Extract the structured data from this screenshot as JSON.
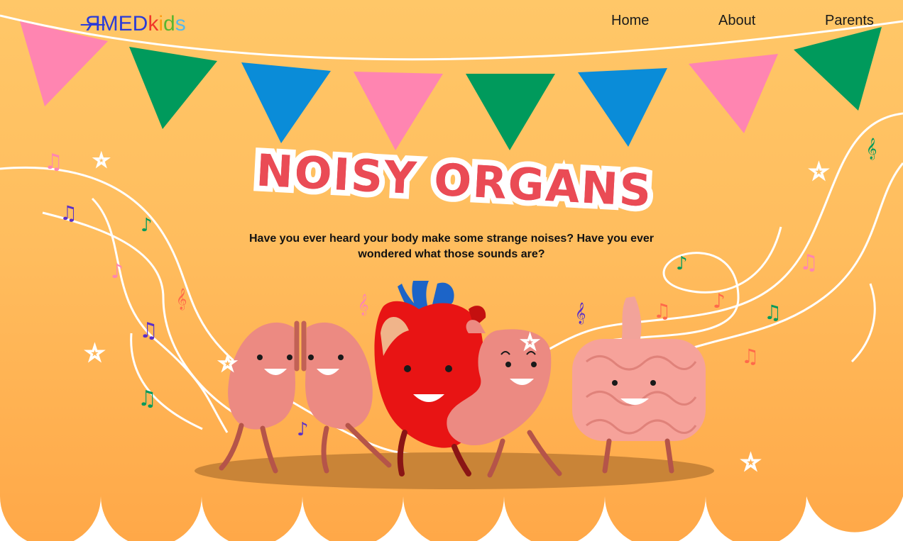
{
  "brand": {
    "logo_text": "RMEDkids",
    "logo_colors": [
      "#2a3bd8",
      "#f0372a",
      "#ff9b10",
      "#5bb52f",
      "#59b8e8"
    ]
  },
  "nav": {
    "items": [
      {
        "label": "Home"
      },
      {
        "label": "About"
      },
      {
        "label": "Parents"
      }
    ]
  },
  "hero": {
    "title": "NOISY ORGANS",
    "subtitle": "Have you ever heard your body make some strange noises? Have you ever wondered what those sounds are?"
  },
  "colors": {
    "background": "#ffc768",
    "title": "#ea4b55",
    "bunting": [
      "#ff85b1",
      "#009a5c",
      "#0a8cd8"
    ],
    "heart": "#e81414",
    "organ_pink": "#ec8a82"
  },
  "illustration": {
    "characters": [
      "lungs",
      "heart",
      "stomach",
      "intestines"
    ],
    "icons": [
      "music-note-icon",
      "treble-clef-icon",
      "star-icon"
    ]
  }
}
